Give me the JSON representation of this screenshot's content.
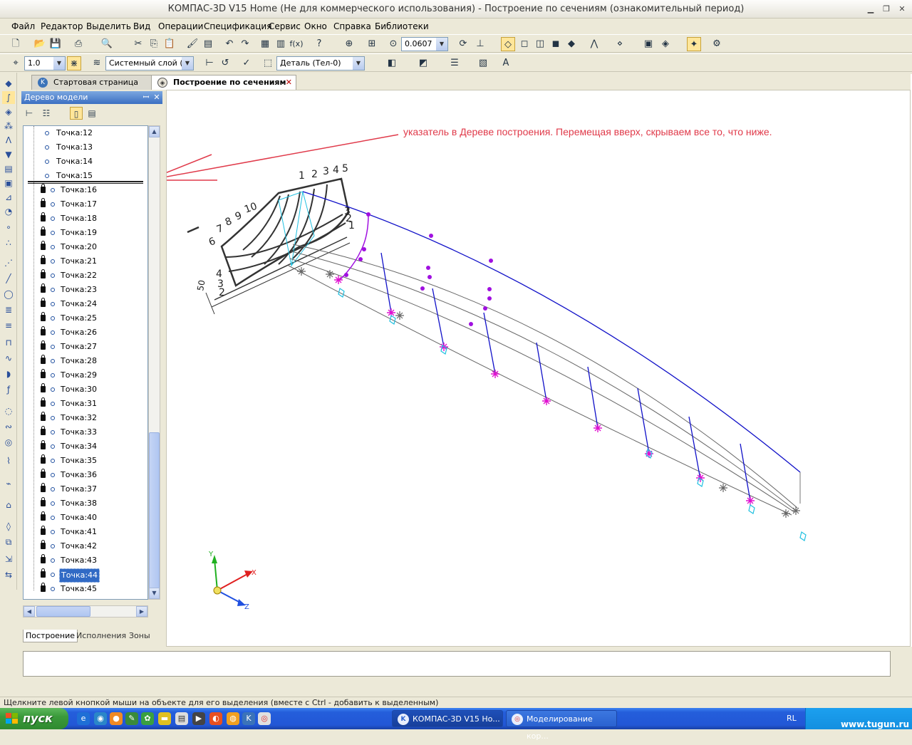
{
  "window": {
    "title": "КОМПАС-3D V15 Home (Не для коммерческого использования) - Построение по сечениям (ознакомительный период)"
  },
  "menu": [
    "Файл",
    "Редактор",
    "Выделить",
    "Вид",
    "Операции",
    "Спецификация",
    "Сервис",
    "Окно",
    "Справка",
    "Библиотеки"
  ],
  "toolbar": {
    "zoom_value": "0.0607",
    "step_value": "1.0",
    "layer_value": "Системный слой (0)",
    "detail_value": "Деталь (Тел-0)",
    "fx_label": "f(x)"
  },
  "tabs": {
    "start": "Стартовая страница",
    "current": "Построение по сечениям"
  },
  "tree": {
    "header": "Дерево модели",
    "items_top": [
      "Точка:12",
      "Точка:13",
      "Точка:14",
      "Точка:15"
    ],
    "items_locked": [
      "Точка:16",
      "Точка:17",
      "Точка:18",
      "Точка:19",
      "Точка:20",
      "Точка:21",
      "Точка:22",
      "Точка:23",
      "Точка:24",
      "Точка:25",
      "Точка:26",
      "Точка:27",
      "Точка:28",
      "Точка:29",
      "Точка:30",
      "Точка:31",
      "Точка:32",
      "Точка:33",
      "Точка:34",
      "Точка:35",
      "Точка:36",
      "Точка:37",
      "Точка:38",
      "Точка:40",
      "Точка:41",
      "Точка:42",
      "Точка:43",
      "Точка:44",
      "Точка:45"
    ],
    "selected": "Точка:44",
    "bottom_tabs": [
      "Построение",
      "Исполнения",
      "Зоны"
    ]
  },
  "canvas": {
    "annotation": "указатель в Дереве построения. Перемещая вверх, скрываем все то, что ниже.",
    "drawing_labels": [
      "1",
      "2",
      "3",
      "4",
      "5",
      "10",
      "9",
      "8",
      "7",
      "6",
      "3",
      "2",
      "1",
      "4",
      "3",
      "2",
      "50"
    ],
    "axes": {
      "x": "X",
      "y": "Y",
      "z": "Z"
    }
  },
  "status": "Щелкните левой кнопкой мыши на объекте для его выделения (вместе с Ctrl - добавить к выделенным)",
  "taskbar": {
    "start": "пуск",
    "tasks": [
      "КОМПАС-3D V15 Ho...",
      "Моделирование кор..."
    ],
    "lang": "RL",
    "watermark": "www.tugun.ru"
  },
  "colors": {
    "annotation": "#e03a4a",
    "hull_blue": "#1010c8",
    "purple": "#a010e0",
    "magenta": "#e010d0",
    "cyan": "#20c0e0",
    "selection": "#316ac5"
  }
}
